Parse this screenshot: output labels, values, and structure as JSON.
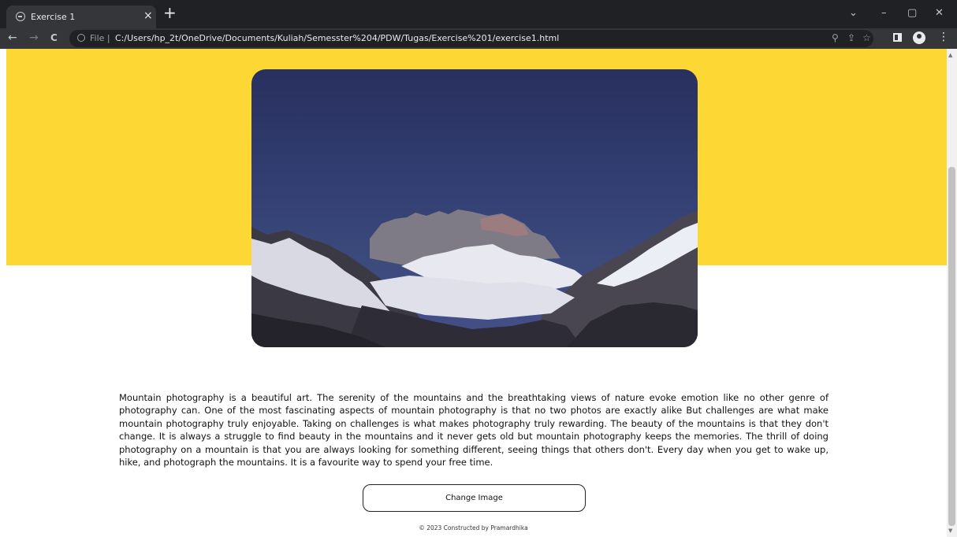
{
  "browser": {
    "tab_title": "Exercise 1",
    "tab_close": "×",
    "new_tab": "+",
    "controls": {
      "dropdown": "⌄",
      "minimize": "–",
      "restore": "▢",
      "close": "✕"
    },
    "nav": {
      "back": "←",
      "forward": "→",
      "reload": "C"
    },
    "file_label": "File |",
    "url": "C:/Users/hp_2t/OneDrive/Documents/Kuliah/Semesster%204/PDW/Tugas/Exercise%201/exercise1.html",
    "icons": [
      "info-icon",
      "zoom-icon",
      "share-icon",
      "star-icon",
      "side-panel-icon",
      "profile-icon",
      "menu-icon"
    ],
    "theme_color": "#202124"
  },
  "page": {
    "hero_color": "#fdd835",
    "image_alt": "Snow-covered mountain range under a dark blue sky",
    "article": "Mountain photography is a beautiful art. The serenity of the mountains and the breathtaking views of nature evoke emotion like no other genre of photography can. One of the most fascinating aspects of mountain photography is that no two photos are exactly alike But challenges are what make mountain photography truly enjoyable. Taking on challenges is what makes photography truly rewarding. The beauty of the mountains is that they don't change. It is always a struggle to find beauty in the mountains and it never gets old but mountain photography keeps the memories. The thrill of doing photography on a mountain is that you are always looking for something different, seeing things that others don't. Every day when you get to wake up, hike, and photograph the mountains. It is a favourite way to spend your free time.",
    "button_label": "Change Image",
    "footer": "© 2023 Constructed by Pramardhika"
  }
}
